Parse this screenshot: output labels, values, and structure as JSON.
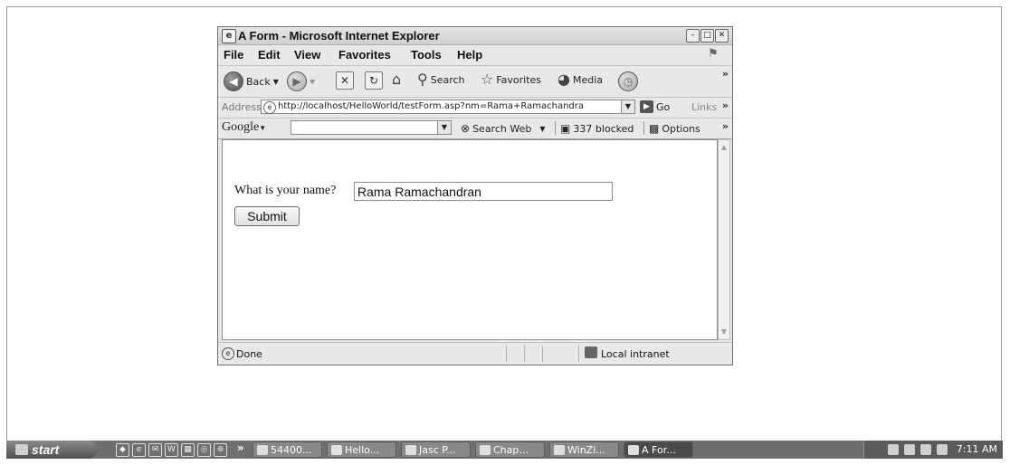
{
  "window": {
    "title": "A Form - Microsoft Internet Explorer",
    "controls": [
      "minimize",
      "maximize",
      "close"
    ]
  },
  "menu": [
    "File",
    "Edit",
    "View",
    "Favorites",
    "Tools",
    "Help"
  ],
  "toolbar": {
    "back": "Back",
    "search": "Search",
    "favorites": "Favorites",
    "media": "Media"
  },
  "address": {
    "label": "Address",
    "url": "http://localhost/HelloWorld/testForm.asp?nm=Rama+Ramachandra",
    "go": "Go",
    "links": "Links"
  },
  "google": {
    "logo": "Google",
    "search_web": "Search Web",
    "blocked": "337 blocked",
    "options": "Options"
  },
  "form": {
    "question": "What is your name?",
    "name_value": "Rama Ramachandran",
    "submit": "Submit"
  },
  "status": {
    "text": "Done",
    "zone": "Local intranet"
  },
  "taskbar": {
    "start": "start",
    "tasks": [
      "54400...",
      "Hello...",
      "Jasc P...",
      "Chap...",
      "WinZi...",
      "A For..."
    ],
    "active_task_index": 5,
    "clock": "7:11 AM"
  }
}
